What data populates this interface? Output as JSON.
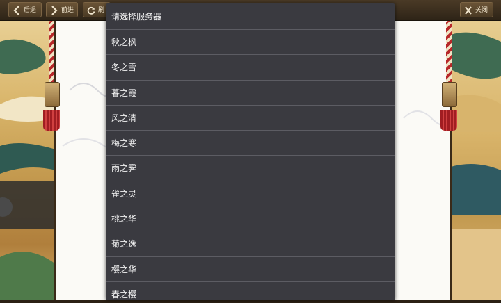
{
  "toolbar": {
    "back_label": "后退",
    "forward_label": "前进",
    "refresh_label": "刷",
    "close_label": "关闭",
    "back_icon": "chevron-left-icon",
    "forward_icon": "chevron-right-icon",
    "refresh_icon": "refresh-icon",
    "close_icon": "close-icon"
  },
  "server_dropdown": {
    "placeholder": "请选择服务器",
    "options": [
      "秋之枫",
      "冬之雪",
      "暮之霞",
      "风之清",
      "梅之寒",
      "雨之霁",
      "雀之灵",
      "桃之华",
      "菊之逸",
      "樱之华",
      "春之樱"
    ]
  },
  "colors": {
    "dropdown_bg": "#3a3a40",
    "dropdown_divider": "#5c5c63",
    "toolbar_bg": "#3b2e1e",
    "tassel_red": "#a11d22"
  }
}
